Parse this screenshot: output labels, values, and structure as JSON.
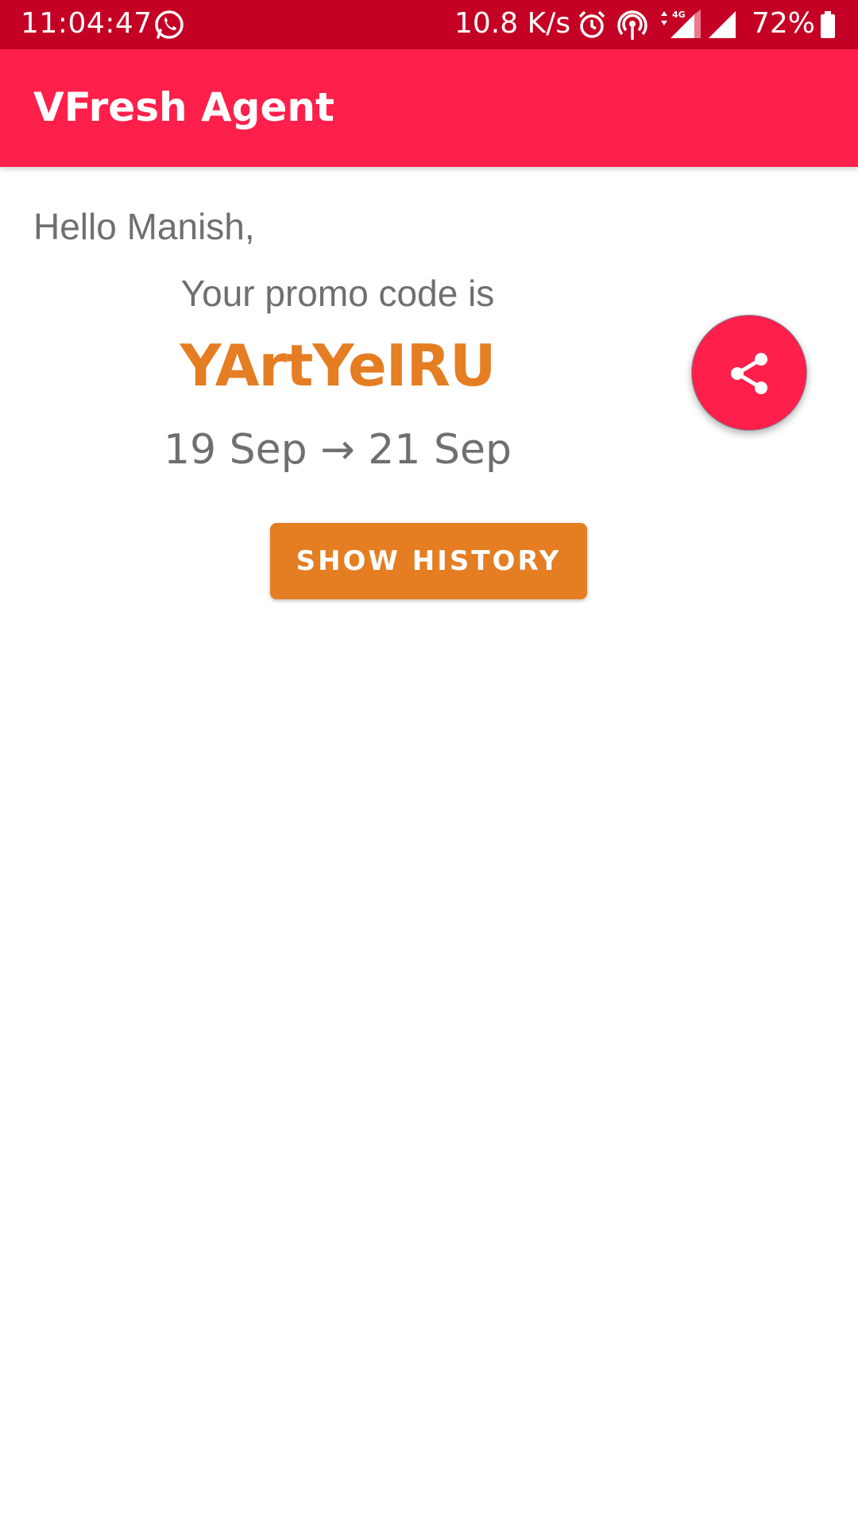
{
  "status_bar": {
    "time": "11:04:47",
    "network_speed": "10.8 K/s",
    "network_type": "4G",
    "battery": "72%",
    "icons": [
      "whatsapp-icon",
      "alarm-icon",
      "hotspot-icon",
      "signal-4g-icon",
      "signal-icon",
      "battery-icon"
    ]
  },
  "app_bar": {
    "title": "VFresh Agent",
    "color": "#ff1f4b"
  },
  "main": {
    "greeting": "Hello Manish,",
    "promo_label": "Your promo code is",
    "promo_code": "YArtYeIRU",
    "date_range": "19 Sep → 21 Sep",
    "history_button_label": "SHOW HISTORY",
    "share_icon": "share-icon",
    "accent_color": "#e57d22"
  }
}
